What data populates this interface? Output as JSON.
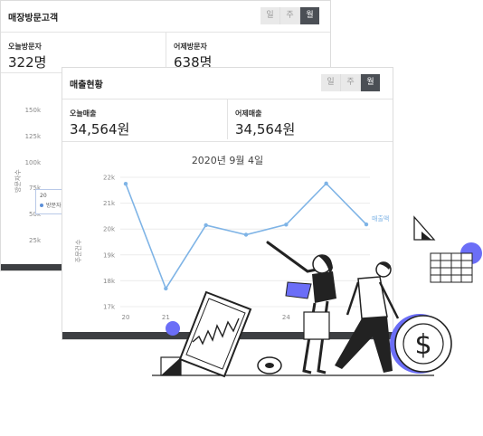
{
  "visitors_card": {
    "title": "매장방문고객",
    "periods": [
      "일",
      "주",
      "월"
    ],
    "active_period": "월",
    "today_label": "오늘방문자",
    "today_value": "322명",
    "yesterday_label": "어제방문자",
    "yesterday_value": "638명",
    "y_axis_label": "방문자수",
    "y_ticks": [
      "150k",
      "125k",
      "100k",
      "75k",
      "50k",
      "25k"
    ],
    "tooltip_label": "20",
    "tooltip_series": "방문자"
  },
  "sales_card": {
    "title": "매출현황",
    "periods": [
      "일",
      "주",
      "월"
    ],
    "active_period": "월",
    "today_label": "오늘매출",
    "today_value": "34,564원",
    "yesterday_label": "어제매출",
    "yesterday_value": "34,564원",
    "chart_title": "2020년 9월 4일"
  },
  "chart_data": {
    "type": "line",
    "title": "2020년 9월 4일",
    "xlabel": "",
    "ylabel": "주문건수",
    "x_ticks": [
      "20",
      "21",
      "",
      "",
      "24"
    ],
    "y_ticks": [
      "22k",
      "21k",
      "20k",
      "19k",
      "18k",
      "17k"
    ],
    "ylim": [
      17000,
      22000
    ],
    "x": [
      20,
      21,
      22,
      23,
      24,
      25,
      26
    ],
    "series": [
      {
        "name": "매출액",
        "values": [
          21750,
          17700,
          20150,
          19780,
          20170,
          21760,
          20180
        ]
      }
    ],
    "grid": true,
    "line_color": "#7fb4e6"
  },
  "colors": {
    "accent_blue": "#6b6ef7",
    "dark_bar": "#3d3f42",
    "line": "#7fb4e6"
  },
  "illustration": {
    "icons": [
      "tablet-chart-icon",
      "coin-dollar-icon",
      "grid-table-icon",
      "triangle-ruler-icon"
    ]
  }
}
